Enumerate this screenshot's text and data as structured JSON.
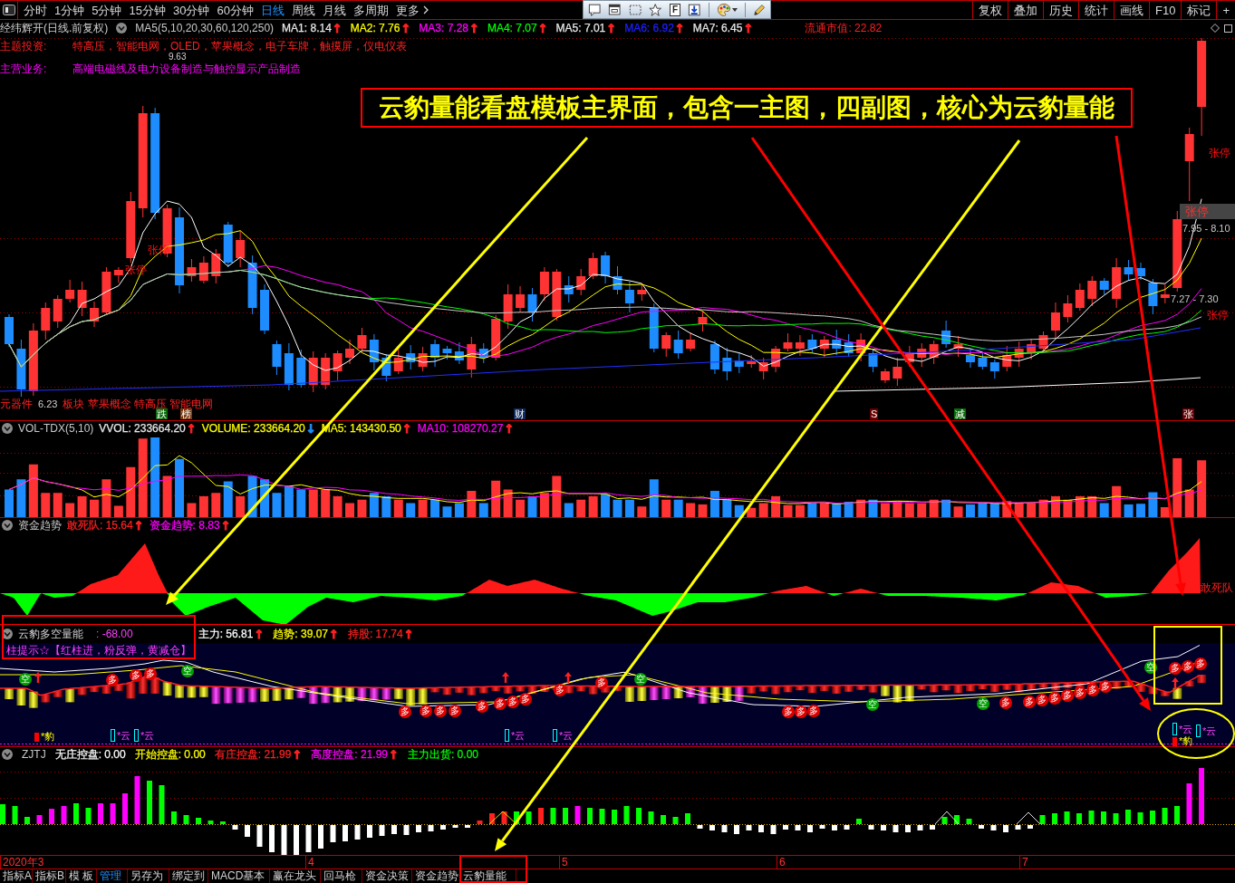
{
  "top_bar": {
    "tabs": [
      {
        "label": "分时",
        "selected": false
      },
      {
        "label": "1分钟",
        "selected": false
      },
      {
        "label": "5分钟",
        "selected": false
      },
      {
        "label": "15分钟",
        "selected": false
      },
      {
        "label": "30分钟",
        "selected": false
      },
      {
        "label": "60分钟",
        "selected": false
      },
      {
        "label": "日线",
        "selected": true
      },
      {
        "label": "周线",
        "selected": false
      },
      {
        "label": "月线",
        "selected": false
      },
      {
        "label": "多周期",
        "selected": false
      },
      {
        "label": "更多",
        "selected": false
      }
    ],
    "buttons": [
      "复权",
      "叠加",
      "历史",
      "统计",
      "画线",
      "F10",
      "标记",
      "+"
    ]
  },
  "floating_toolbar": {
    "letter_key": "F"
  },
  "main_chart": {
    "title": "经纬辉开(日线.前复权)",
    "indicator": "MA5(5,10,20,30,60,120,250)",
    "readouts": [
      {
        "label": "MA1: 8.14",
        "color": "#e8e8e8",
        "arrow": {
          "text": "↑",
          "color": "#ff2020"
        }
      },
      {
        "label": "MA2: 7.76",
        "color": "#ffff00",
        "arrow": {
          "text": "↑",
          "color": "#ff2020"
        }
      },
      {
        "label": "MA3: 7.28",
        "color": "#ff00ff",
        "arrow": {
          "text": "↑",
          "color": "#ff2020"
        }
      },
      {
        "label": "MA4: 7.07",
        "color": "#00ff00",
        "arrow": {
          "text": "↑",
          "color": "#ff2020"
        }
      },
      {
        "label": "MA5: 7.01",
        "color": "#e8e8e8",
        "arrow": {
          "text": "↑",
          "color": "#ff2020"
        }
      },
      {
        "label": "MA6: 6.92",
        "color": "#2020ff",
        "arrow": {
          "text": "↑",
          "color": "#ff2020"
        }
      },
      {
        "label": "MA7: 6.45",
        "color": "#e8e8e8",
        "arrow": {
          "text": "↑",
          "color": "#ff2020"
        }
      }
    ],
    "market_cap": "流通市值: 22.82",
    "theme": {
      "label": "主题投资:",
      "text": "特高压，智能电网，OLED，苹果概念，电子车牌，触摸屏，仪电仪表"
    },
    "business": {
      "label": "主营业务:",
      "text": "高端电磁线及电力设备制造与触控显示产品制造"
    },
    "high_price": "9.63",
    "low_price": "6.23",
    "concept_prefix": "元器件",
    "concept_text": "板块 苹果概念 特高压 智能电网",
    "limit_labels": [
      {
        "kind": "plain",
        "label": "张停"
      },
      {
        "kind": "plain",
        "label": "张停"
      },
      {
        "kind": "plain",
        "label": "张停"
      },
      {
        "kind": "boxed",
        "label": "张停"
      },
      {
        "kind": "plain",
        "label": "张停"
      }
    ],
    "price_ranges": [
      "7.95 - 8.10",
      "7.27 - 7.30"
    ],
    "badges": [
      {
        "label": "跌",
        "color": "#0a6a0a"
      },
      {
        "label": "榜",
        "color": "#7a3a10"
      },
      {
        "label": "财",
        "color": "#102a5a"
      },
      {
        "label": "S",
        "color": "#6a0000"
      },
      {
        "label": "减",
        "color": "#0a6a0a"
      },
      {
        "label": "张",
        "color": "#6a0000"
      }
    ]
  },
  "annotation": {
    "text": "云豹量能看盘模板主界面，包含一主图，四副图，核心为云豹量能"
  },
  "volume_panel": {
    "name": "VOL-TDX(5,10)",
    "readouts": [
      {
        "label": "VVOL: 233664.20",
        "color": "#e8e8e8",
        "arrow": {
          "text": "↑",
          "color": "#ff2020"
        }
      },
      {
        "label": "VOLUME: 233664.20",
        "color": "#ffff00",
        "arrow": {
          "text": "↓",
          "color": "#1e90ff"
        }
      },
      {
        "label": "MA5: 143430.50",
        "color": "#ffff00",
        "arrow": {
          "text": "↑",
          "color": "#ff2020"
        }
      },
      {
        "label": "MA10: 108270.27",
        "color": "#ff00ff",
        "arrow": {
          "text": "↑",
          "color": "#ff2020"
        }
      }
    ]
  },
  "fund_panel": {
    "name": "资金趋势",
    "readouts": [
      {
        "label": "敢死队: 15.64",
        "color": "#ff2020",
        "arrow": {
          "text": "↑",
          "color": "#ff2020"
        }
      },
      {
        "label": "资金趋势: 8.83",
        "color": "#ff00ff",
        "arrow": {
          "text": "↑",
          "color": "#ff2020"
        }
      }
    ],
    "series_label": "敢死队"
  },
  "yunbao_panel": {
    "name": "云豹多空量能",
    "value": ": -68.00",
    "readouts": [
      {
        "label": "主力: 56.81",
        "color": "#ffffff",
        "arrow": {
          "text": "↑",
          "color": "#ff2020"
        }
      },
      {
        "label": "趋势: 39.07",
        "color": "#ffff00",
        "arrow": {
          "text": "↑",
          "color": "#ff2020"
        }
      },
      {
        "label": "持股: 17.74",
        "color": "#ff2020",
        "arrow": {
          "text": "↑",
          "color": "#ff2020"
        }
      }
    ],
    "hint": "柱提示☆【红柱进，粉反弹，黄减仓】",
    "markers": [
      {
        "kind": "short",
        "label": "空"
      },
      {
        "kind": "long",
        "label": "多"
      },
      {
        "kind": "long",
        "label": "多"
      },
      {
        "kind": "long",
        "label": "多"
      },
      {
        "kind": "short",
        "label": "空"
      },
      {
        "kind": "long",
        "label": "多"
      },
      {
        "kind": "long",
        "label": "多"
      },
      {
        "kind": "long",
        "label": "多"
      },
      {
        "kind": "long",
        "label": "多"
      },
      {
        "kind": "long",
        "label": "多"
      },
      {
        "kind": "long",
        "label": "多"
      },
      {
        "kind": "long",
        "label": "多"
      },
      {
        "kind": "long",
        "label": "多"
      },
      {
        "kind": "long",
        "label": "多"
      },
      {
        "kind": "long",
        "label": "多"
      },
      {
        "kind": "short",
        "label": "空"
      },
      {
        "kind": "long",
        "label": "多"
      },
      {
        "kind": "long",
        "label": "多"
      },
      {
        "kind": "long",
        "label": "多"
      },
      {
        "kind": "short",
        "label": "空"
      },
      {
        "kind": "short",
        "label": "空"
      },
      {
        "kind": "long",
        "label": "多"
      },
      {
        "kind": "long",
        "label": "多"
      },
      {
        "kind": "long",
        "label": "多"
      },
      {
        "kind": "long",
        "label": "多"
      },
      {
        "kind": "long",
        "label": "多"
      },
      {
        "kind": "long",
        "label": "多"
      },
      {
        "kind": "long",
        "label": "多"
      },
      {
        "kind": "long",
        "label": "多"
      },
      {
        "kind": "short",
        "label": "空"
      },
      {
        "kind": "long",
        "label": "多"
      },
      {
        "kind": "long",
        "label": "多"
      },
      {
        "kind": "long",
        "label": "多"
      }
    ],
    "flags": [
      {
        "kind": "leopard",
        "label": "*豹"
      },
      {
        "kind": "cloud",
        "label": "*云"
      },
      {
        "kind": "cloud",
        "label": "*云"
      },
      {
        "kind": "cloud",
        "label": "*云"
      },
      {
        "kind": "cloud",
        "label": "*云"
      },
      {
        "kind": "cloud",
        "label": "*云"
      },
      {
        "kind": "leopard",
        "label": "*豹"
      },
      {
        "kind": "cloud",
        "label": "*云"
      }
    ]
  },
  "zjtj_panel": {
    "name": "ZJTJ",
    "readouts": [
      {
        "label": "无庄控盘: 0.00",
        "color": "#ffffff"
      },
      {
        "label": "开始控盘: 0.00",
        "color": "#ffff00"
      },
      {
        "label": "有庄控盘: 21.99",
        "color": "#ff2020",
        "arrow": {
          "text": "↑",
          "color": "#ff2020"
        }
      },
      {
        "label": "高度控盘: 21.99",
        "color": "#ff00ff",
        "arrow": {
          "text": "↑",
          "color": "#ff2020"
        }
      },
      {
        "label": "主力出货: 0.00",
        "color": "#00ff00"
      }
    ]
  },
  "date_axis": [
    "2020年3",
    "4",
    "5",
    "6",
    "7"
  ],
  "bottom_tabs": [
    {
      "label": "指标A",
      "selected": false
    },
    {
      "label": "指标B",
      "selected": false
    },
    {
      "label": "模 板",
      "selected": false
    },
    {
      "label": "管理",
      "selected": true
    },
    {
      "label": "另存为",
      "selected": false
    },
    {
      "label": "绑定到",
      "selected": false
    },
    {
      "label": "MACD基本",
      "selected": false
    },
    {
      "label": "赢在龙头",
      "selected": false
    },
    {
      "label": "回马枪",
      "selected": false
    },
    {
      "label": "资金决策",
      "selected": false
    },
    {
      "label": "资金趋势",
      "selected": false
    },
    {
      "label": "云豹量能",
      "selected": false
    }
  ]
}
